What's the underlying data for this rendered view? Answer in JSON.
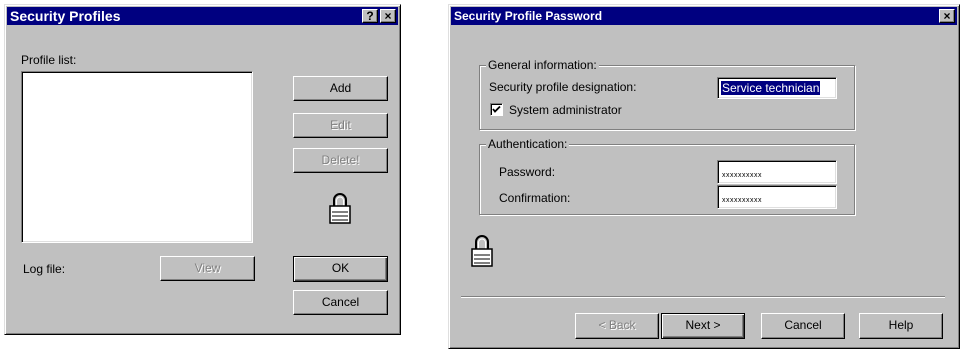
{
  "dialog1": {
    "title": "Security Profiles",
    "help_button": "?",
    "close_button": "×",
    "profile_list_label": "Profile list:",
    "profile_items": [],
    "log_file_label": "Log file:",
    "buttons": {
      "add": "Add",
      "edit": "Edit",
      "delete": "Delete!",
      "view": "View",
      "ok": "OK",
      "cancel": "Cancel"
    },
    "icons": {
      "lock": "padlock-icon"
    }
  },
  "dialog2": {
    "title": "Security Profile Password",
    "close_button": "×",
    "general_group": {
      "legend": "General information:",
      "designation_label": "Security profile designation:",
      "designation_value": "Service technician",
      "system_admin_label": "System administrator",
      "system_admin_checked": true
    },
    "auth_group": {
      "legend": "Authentication:",
      "password_label": "Password:",
      "password_value": "xxxxxxxxxx",
      "confirmation_label": "Confirmation:",
      "confirmation_value": "xxxxxxxxxx"
    },
    "buttons": {
      "back": "< Back",
      "next": "Next >",
      "cancel": "Cancel",
      "help": "Help"
    },
    "icons": {
      "lock": "padlock-icon"
    }
  }
}
